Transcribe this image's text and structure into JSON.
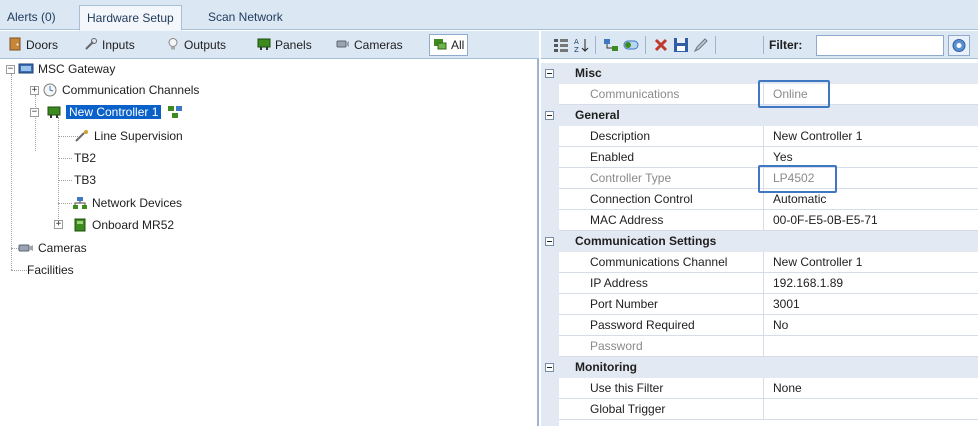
{
  "top_tabs": [
    "Alerts (0)",
    "Hardware Setup",
    "Scan Network"
  ],
  "left_toolbar": [
    {
      "label": "Doors",
      "icon": "door-icon"
    },
    {
      "label": "Inputs",
      "icon": "input-icon"
    },
    {
      "label": "Outputs",
      "icon": "bulb-icon"
    },
    {
      "label": "Panels",
      "icon": "panel-icon"
    },
    {
      "label": "Cameras",
      "icon": "camera-icon"
    },
    {
      "label": "All",
      "icon": "all-icon"
    }
  ],
  "tree": {
    "root": "MSC Gateway",
    "channels": "Communication Channels",
    "controller": "New Controller  1",
    "line_supervision": "Line Supervision",
    "tb2": "TB2",
    "tb3": "TB3",
    "network_devices": "Network Devices",
    "onboard": "Onboard MR52",
    "cameras": "Cameras",
    "facilities": "Facilities"
  },
  "filter": {
    "label": "Filter:",
    "value": ""
  },
  "colors": {
    "accent": "#0a61c9",
    "highlight": "#3e78c2"
  },
  "properties": {
    "misc": {
      "title": "Misc",
      "communications_k": "Communications",
      "communications_v": "Online"
    },
    "general": {
      "title": "General",
      "description_k": "Description",
      "description_v": "New Controller  1",
      "enabled_k": "Enabled",
      "enabled_v": "Yes",
      "ctype_k": "Controller Type",
      "ctype_v": "LP4502",
      "conn_k": "Connection Control",
      "conn_v": "Automatic",
      "mac_k": "MAC Address",
      "mac_v": "00-0F-E5-0B-E5-71"
    },
    "comm": {
      "title": "Communication Settings",
      "channel_k": "Communications Channel",
      "channel_v": "New Controller  1",
      "ip_k": "IP Address",
      "ip_v": "192.168.1.89",
      "port_k": "Port Number",
      "port_v": "3001",
      "pwreq_k": "Password Required",
      "pwreq_v": "No",
      "pw_k": "Password",
      "pw_v": ""
    },
    "monitoring": {
      "title": "Monitoring",
      "filter_k": "Use this Filter",
      "filter_v": "None",
      "trigger_k": "Global Trigger",
      "trigger_v": ""
    }
  }
}
